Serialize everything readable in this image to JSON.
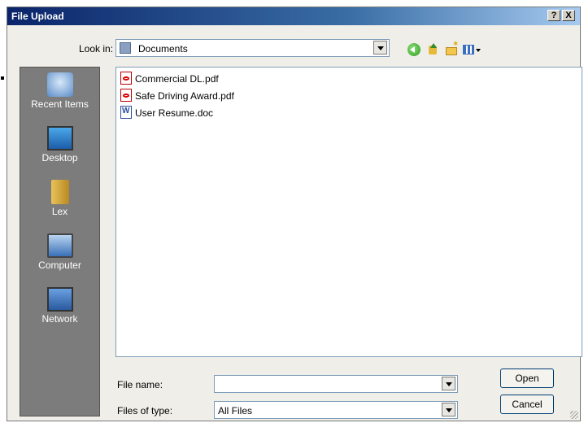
{
  "window": {
    "title": "File Upload",
    "help_label": "?",
    "close_label": "X"
  },
  "toolbar": {
    "look_in_label": "Look in:",
    "look_in_value": "Documents",
    "icons": [
      "back-icon",
      "up-folder-icon",
      "new-folder-icon",
      "views-menu-icon"
    ]
  },
  "places": [
    {
      "label": "Recent Items",
      "icon": "recent-items-icon"
    },
    {
      "label": "Desktop",
      "icon": "desktop-icon"
    },
    {
      "label": "Lex",
      "icon": "user-folder-icon"
    },
    {
      "label": "Computer",
      "icon": "computer-icon"
    },
    {
      "label": "Network",
      "icon": "network-icon"
    }
  ],
  "files": [
    {
      "name": "Commercial DL.pdf",
      "icon": "pdf-icon"
    },
    {
      "name": "Safe Driving Award.pdf",
      "icon": "pdf-icon"
    },
    {
      "name": "User Resume.doc",
      "icon": "word-doc-icon"
    }
  ],
  "form": {
    "file_name_label": "File name:",
    "file_name_value": "",
    "files_of_type_label": "Files of type:",
    "files_of_type_value": "All Files"
  },
  "buttons": {
    "open_label": "Open",
    "cancel_label": "Cancel"
  }
}
